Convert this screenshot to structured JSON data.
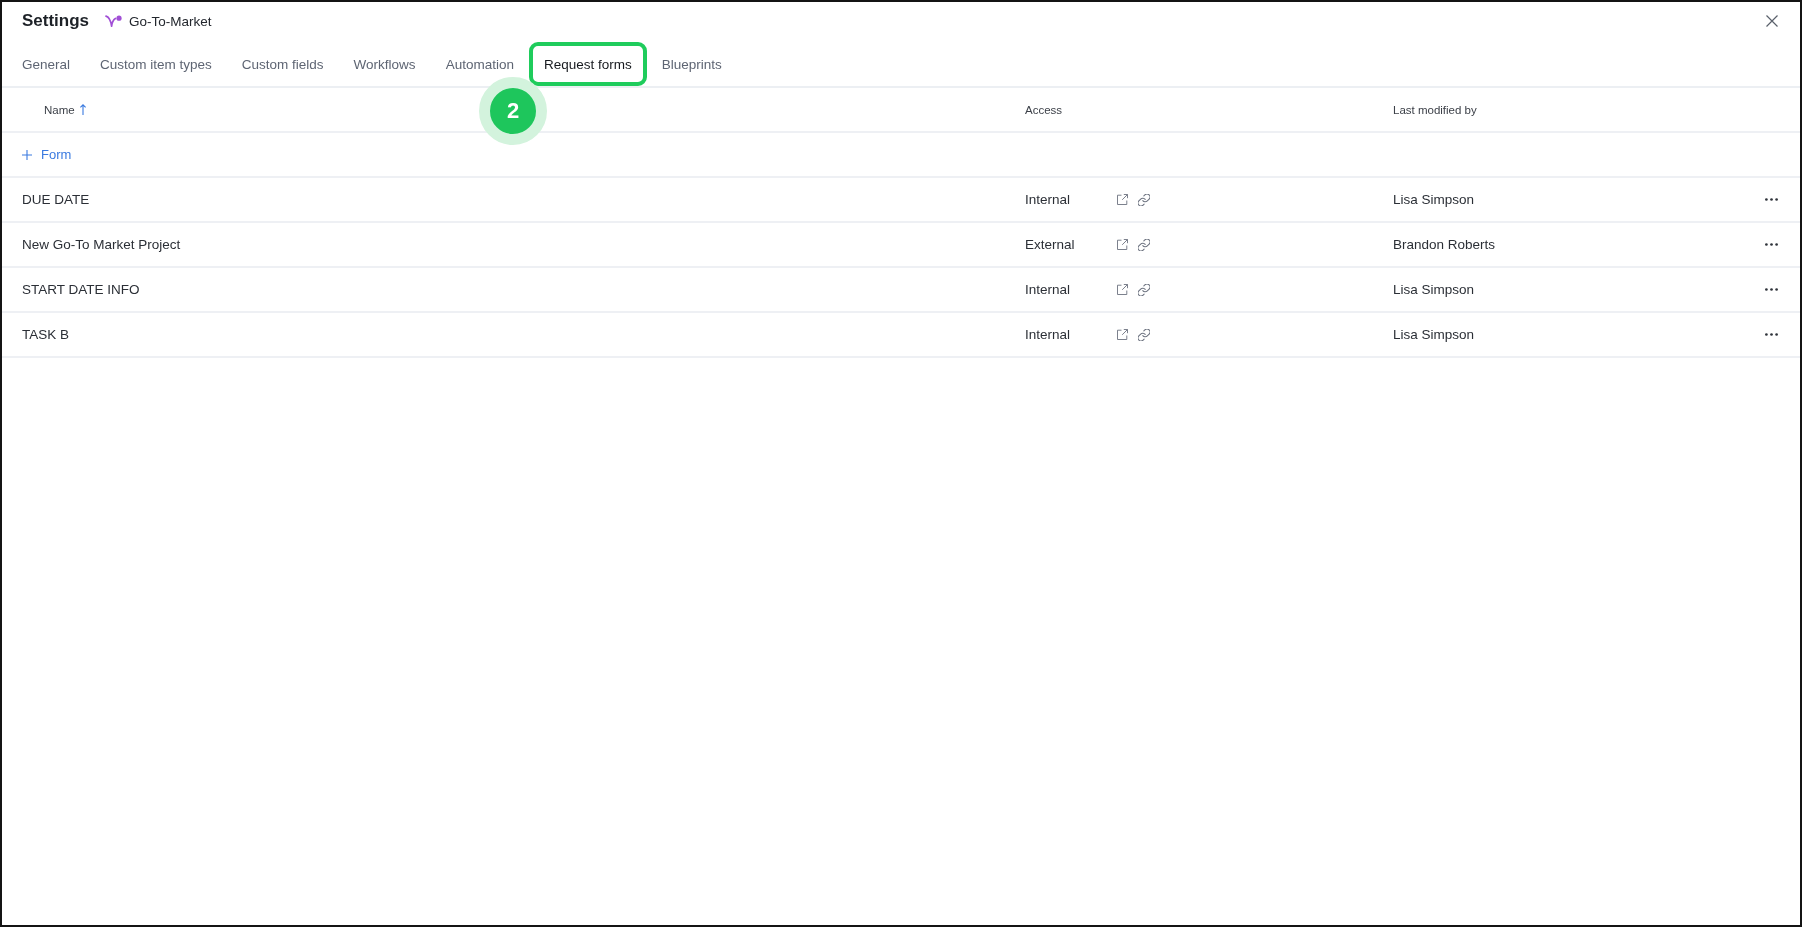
{
  "window": {
    "title": "Settings",
    "workspace": "Go-To-Market"
  },
  "tabs": [
    {
      "label": "General",
      "selected": false,
      "highlighted": false
    },
    {
      "label": "Custom item types",
      "selected": false,
      "highlighted": false
    },
    {
      "label": "Custom fields",
      "selected": false,
      "highlighted": false
    },
    {
      "label": "Workflows",
      "selected": false,
      "highlighted": false
    },
    {
      "label": "Automation",
      "selected": false,
      "highlighted": false
    },
    {
      "label": "Request forms",
      "selected": true,
      "highlighted": true
    },
    {
      "label": "Blueprints",
      "selected": false,
      "highlighted": false
    }
  ],
  "step_badge": "2",
  "table": {
    "columns": [
      {
        "label": "Name",
        "sorted": true
      },
      {
        "label": "Access",
        "sorted": false
      },
      {
        "label": "Last modified by",
        "sorted": false
      }
    ],
    "add_button": "Form",
    "rows": [
      {
        "name": "DUE DATE",
        "access": "Internal",
        "modified_by": "Lisa Simpson"
      },
      {
        "name": "New Go-To Market Project",
        "access": "External",
        "modified_by": "Brandon Roberts"
      },
      {
        "name": "START DATE INFO",
        "access": "Internal",
        "modified_by": "Lisa Simpson"
      },
      {
        "name": "TASK B",
        "access": "Internal",
        "modified_by": "Lisa Simpson"
      }
    ]
  }
}
